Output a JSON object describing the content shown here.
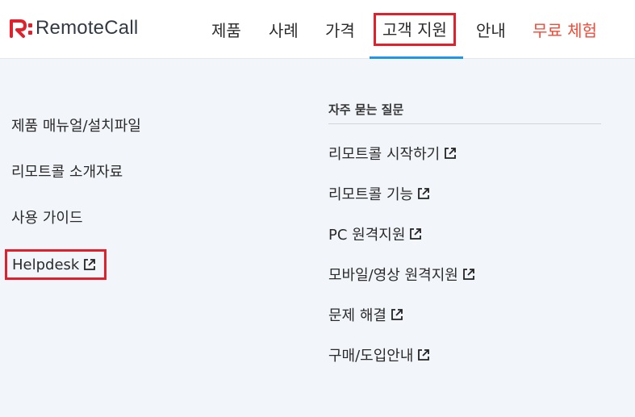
{
  "header": {
    "logo_text": "RemoteCall",
    "nav": [
      {
        "label": "제품"
      },
      {
        "label": "사례"
      },
      {
        "label": "가격"
      },
      {
        "label": "고객 지원"
      },
      {
        "label": "안내"
      },
      {
        "label": "무료 체험"
      }
    ],
    "active_nav": "고객 지원"
  },
  "menu": {
    "left_items": [
      {
        "label": "제품 매뉴얼/설치파일"
      },
      {
        "label": "리모트콜 소개자료"
      },
      {
        "label": "사용 가이드"
      },
      {
        "label": "Helpdesk",
        "icon": "external-link-icon"
      }
    ],
    "faq": {
      "title": "자주 묻는 질문",
      "items": [
        {
          "label": "리모트콜 시작하기",
          "icon": "external-link-icon"
        },
        {
          "label": "리모트콜 기능",
          "icon": "external-link-icon"
        },
        {
          "label": "PC 원격지원",
          "icon": "external-link-icon"
        },
        {
          "label": "모바일/영상 원격지원",
          "icon": "external-link-icon"
        },
        {
          "label": "문제 해결",
          "icon": "external-link-icon"
        },
        {
          "label": "구매/도입안내",
          "icon": "external-link-icon"
        }
      ]
    }
  },
  "colors": {
    "brand_red": "#e0212b",
    "trial_red": "#ef4a38",
    "active_underline": "#2196e8",
    "menu_background": "#f2f6fb"
  }
}
